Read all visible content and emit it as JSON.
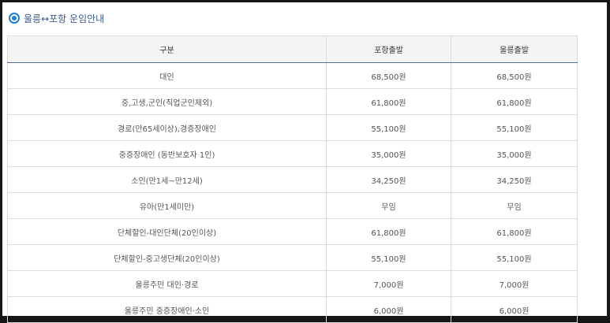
{
  "title": "울릉↔포항 운임안내",
  "icon": "circle-bullet-icon",
  "accent_color": "#1f7fd1",
  "table": {
    "headers": [
      "구분",
      "포항출발",
      "울릉출발"
    ],
    "rows": [
      [
        "대인",
        "68,500원",
        "68,500원"
      ],
      [
        "중,고생,군인(직업군인제외)",
        "61,800원",
        "61,800원"
      ],
      [
        "경로(만65세이상),경증장애인",
        "55,100원",
        "55,100원"
      ],
      [
        "중증장애인 (동반보호자 1인)",
        "35,000원",
        "35,000원"
      ],
      [
        "소인(만1세~만12세)",
        "34,250원",
        "34,250원"
      ],
      [
        "유아(만1세미만)",
        "무임",
        "무임"
      ],
      [
        "단체할인-대인단체(20인이상)",
        "61,800원",
        "61,800원"
      ],
      [
        "단체할인-중고생단체(20인이상)",
        "55,100원",
        "55,100원"
      ],
      [
        "울릉주민 대인·경로",
        "7,000원",
        "7,000원"
      ],
      [
        "울릉주민 중증장애인·소인",
        "6,000원",
        "6,000원"
      ]
    ]
  }
}
